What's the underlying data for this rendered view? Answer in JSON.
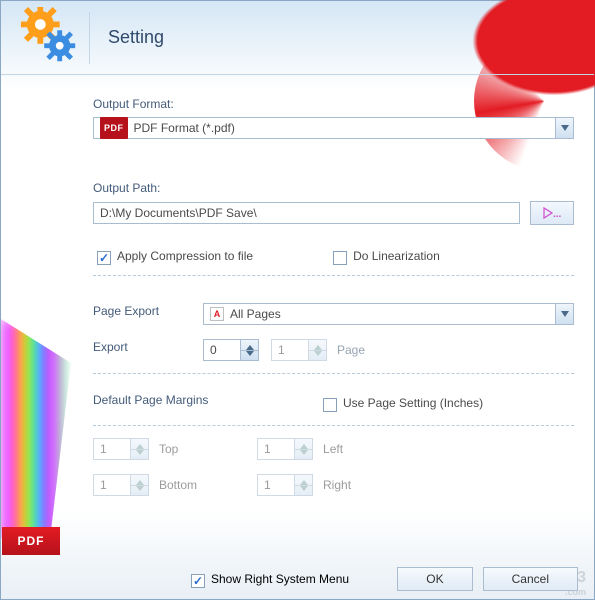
{
  "header": {
    "title": "Setting"
  },
  "outputFormat": {
    "label": "Output Format:",
    "tag": "PDF",
    "selected": "PDF Format (*.pdf)"
  },
  "outputPath": {
    "label": "Output Path:",
    "value": "D:\\My Documents\\PDF Save\\",
    "browse": "..."
  },
  "options": {
    "compressionLabel": "Apply Compression to file",
    "compressionChecked": true,
    "linearizationLabel": "Do Linearization",
    "linearizationChecked": false
  },
  "pageExport": {
    "label": "Page Export",
    "selected": "All Pages",
    "exportLabel": "Export",
    "from": "0",
    "to": "1",
    "pageLabel": "Page"
  },
  "margins": {
    "title": "Default Page Margins",
    "useSettingLabel": "Use Page Setting (Inches)",
    "useSettingChecked": false,
    "top": "1",
    "topLabel": "Top",
    "bottom": "1",
    "bottomLabel": "Bottom",
    "left": "1",
    "leftLabel": "Left",
    "right": "1",
    "rightLabel": "Right"
  },
  "footer": {
    "showMenuLabel": "Show Right System Menu",
    "showMenuChecked": true,
    "ok": "OK",
    "cancel": "Cancel"
  },
  "watermark": {
    "name": "9553",
    "sub": ".com"
  },
  "badge": "PDF"
}
